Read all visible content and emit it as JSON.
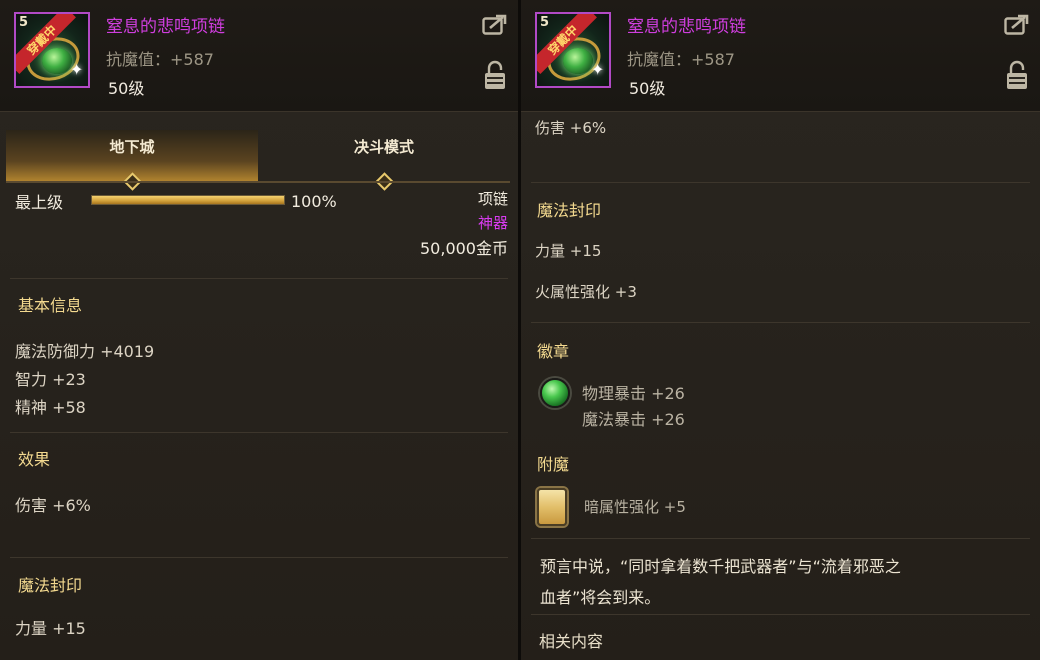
{
  "item": {
    "name": "窒息的悲鸣项链",
    "stat": "抗魔值：+587",
    "level": "50级",
    "icon_level": "5",
    "equipped_badge": "穿戴中"
  },
  "tabs": [
    {
      "label": "地下城",
      "active": true
    },
    {
      "label": "决斗模式",
      "active": false
    }
  ],
  "left": {
    "grade_label": "最上级",
    "grade_percent": "100%",
    "grade_fill": 1.0,
    "slot": "项链",
    "rarity": "神器",
    "price": "50,000金币",
    "basic_info": {
      "title": "基本信息",
      "lines": [
        "魔法防御力 +4019",
        "智力 +23",
        "精神 +58"
      ]
    },
    "effect": {
      "title": "效果",
      "line": "伤害 +6%"
    },
    "seal": {
      "title": "魔法封印",
      "line": "力量 +15"
    }
  },
  "right": {
    "effect_line": "伤害 +6%",
    "seal": {
      "title": "魔法封印",
      "lines": [
        "力量 +15",
        "火属性强化 +3"
      ]
    },
    "emblem": {
      "title": "徽章",
      "lines": [
        "物理暴击 +26",
        "魔法暴击 +26"
      ]
    },
    "enchant": {
      "title": "附魔",
      "line": "暗属性强化 +5"
    },
    "flavor": [
      "预言中说，“同时拿着数千把武器者”与“流着邪恶之",
      "血者”将会到来。"
    ],
    "related_title": "相关内容"
  },
  "colors": {
    "item_name": "#cf3ede",
    "rarity": "#d83cf0",
    "section_title": "#f3d98f",
    "bar_fill": "#d2a13a"
  },
  "icons": [
    "share-icon",
    "lock-icon",
    "gem-orb-icon",
    "enchant-card-icon",
    "diamond-icon"
  ]
}
